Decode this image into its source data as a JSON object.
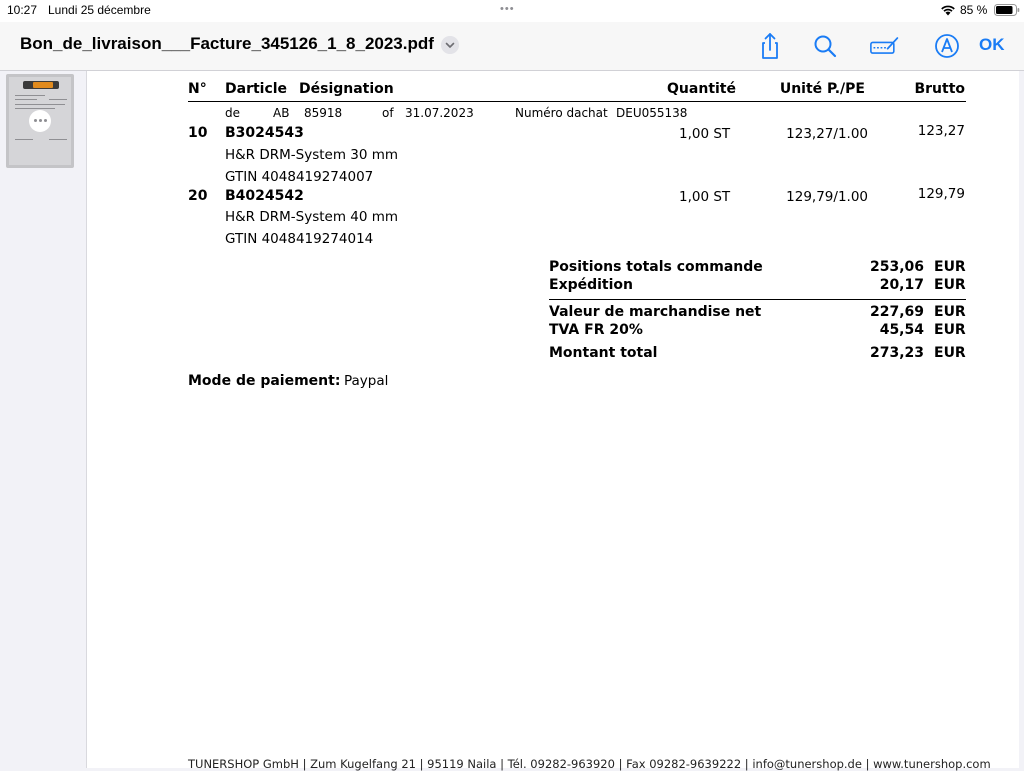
{
  "status_bar": {
    "time": "10:27",
    "date": "Lundi 25 décembre",
    "battery": "85 %",
    "dots": "•••"
  },
  "nav": {
    "title": "Bon_de_livraison___Facture_345126_1_8_2023.pdf",
    "ok_label": "OK",
    "accent_color": "#1a7cf5",
    "icons": [
      "share-icon",
      "search-icon",
      "markup-icon",
      "pencil-circle-icon"
    ]
  },
  "thumbnail": {
    "more_icon": "ellipsis-icon"
  },
  "document": {
    "columns": {
      "no": "N°",
      "article": "Darticle",
      "designation": "Désignation",
      "quantity": "Quantité",
      "unit_price": "Unité P./PE",
      "gross": "Brutto"
    },
    "order_ref": {
      "de": "de",
      "ab": "AB",
      "ab_number": "85918",
      "of": "of",
      "date": "31.07.2023",
      "purchase_label": "Numéro dachat",
      "purchase_number": "DEU055138"
    },
    "items": [
      {
        "no": "10",
        "article": "B3024543",
        "description": "H&R DRM-System 30 mm",
        "gtin": "GTIN 4048419274007",
        "quantity": "1,00 ST",
        "unit_price": "123,27/1.00",
        "gross": "123,27"
      },
      {
        "no": "20",
        "article": "B4024542",
        "description": "H&R DRM-System 40 mm",
        "gtin": "GTIN 4048419274014",
        "quantity": "1,00 ST",
        "unit_price": "129,79/1.00",
        "gross": "129,79"
      }
    ],
    "totals": [
      {
        "label": "Positions totals commande",
        "value": "253,06",
        "currency": "EUR"
      },
      {
        "label": "Expédition",
        "value": "20,17",
        "currency": "EUR"
      },
      {
        "label": "Valeur de marchandise net",
        "value": "227,69",
        "currency": "EUR"
      },
      {
        "label": "TVA FR 20%",
        "value": "45,54",
        "currency": "EUR"
      },
      {
        "label": "Montant total",
        "value": "273,23",
        "currency": "EUR"
      }
    ],
    "payment": {
      "label": "Mode de paiement:",
      "value": "Paypal"
    },
    "footer": "TUNERSHOP GmbH | Zum Kugelfang 21 | 95119 Naila | Tél. 09282-963920 | Fax 09282-9639222 | info@tunershop.de | www.tunershop.com"
  }
}
